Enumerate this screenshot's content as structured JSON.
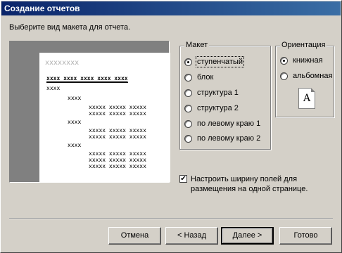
{
  "window": {
    "title": "Создание отчетов"
  },
  "prompt": "Выберите вид макета для отчета.",
  "preview": {
    "title_text": "xxxxxxxx",
    "header_row": "xxxx xxxx xxxx xxxx xxxx",
    "group1": "xxxx",
    "group2": "xxxx",
    "detail": "xxxxx xxxxx xxxxx"
  },
  "layout_group": {
    "legend": "Макет",
    "options": [
      "ступенчатый",
      "блок",
      "структура 1",
      "структура 2",
      "по левому краю 1",
      "по левому краю 2"
    ],
    "selected": "ступенчатый"
  },
  "orientation_group": {
    "legend": "Ориентация",
    "options": [
      "книжная",
      "альбомная"
    ],
    "selected": "книжная",
    "page_letter": "A"
  },
  "fit_checkbox": {
    "label": "Настроить ширину полей для размещения на одной странице.",
    "checked": true,
    "mark": "✔"
  },
  "buttons": {
    "cancel": "Отмена",
    "back": "< Назад",
    "next": "Далее >",
    "finish": "Готово"
  }
}
